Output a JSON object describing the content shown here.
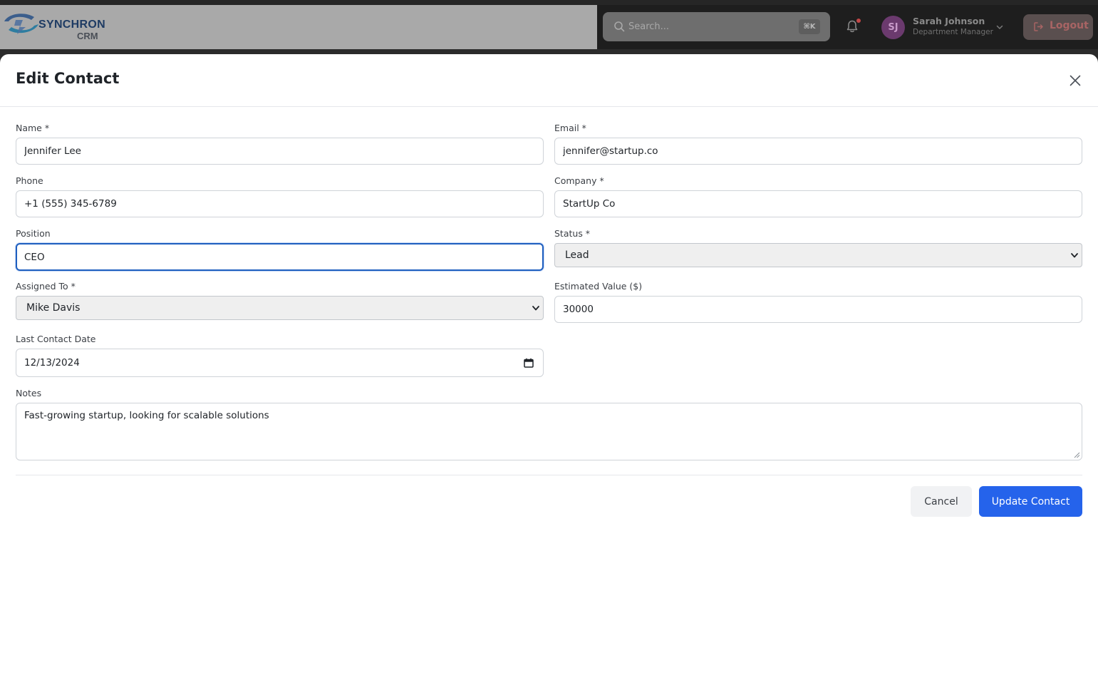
{
  "app": {
    "logo_word": "SYNCHRON",
    "logo_sub": "CRM"
  },
  "header": {
    "search_placeholder": "Search...",
    "search_shortcut": "⌘K",
    "user_initials": "SJ",
    "user_name": "Sarah Johnson",
    "user_role": "Department Manager",
    "logout_label": "Logout"
  },
  "modal": {
    "title": "Edit Contact",
    "fields": {
      "name": {
        "label": "Name *",
        "value": "Jennifer Lee"
      },
      "email": {
        "label": "Email *",
        "value": "jennifer@startup.co"
      },
      "phone": {
        "label": "Phone",
        "value": "+1 (555) 345-6789"
      },
      "company": {
        "label": "Company *",
        "value": "StartUp Co"
      },
      "position": {
        "label": "Position",
        "value": "CEO"
      },
      "status": {
        "label": "Status *",
        "value": "Lead"
      },
      "assigned_to": {
        "label": "Assigned To *",
        "value": "Mike Davis"
      },
      "estimated_value": {
        "label": "Estimated Value ($)",
        "value": "30000"
      },
      "last_contact_date": {
        "label": "Last Contact Date",
        "value": "12/13/2024"
      },
      "notes": {
        "label": "Notes",
        "value": "Fast-growing startup, looking for scalable solutions"
      }
    },
    "cancel_label": "Cancel",
    "submit_label": "Update Contact"
  },
  "colors": {
    "primary": "#2563eb",
    "focus_ring": "#1f5fbf",
    "avatar": "#6b3a6e",
    "notification_dot": "#c24747"
  },
  "icons": [
    "synchron-logo-icon",
    "search-icon",
    "bell-icon",
    "chevron-down-icon",
    "logout-icon",
    "close-icon",
    "calendar-icon"
  ]
}
